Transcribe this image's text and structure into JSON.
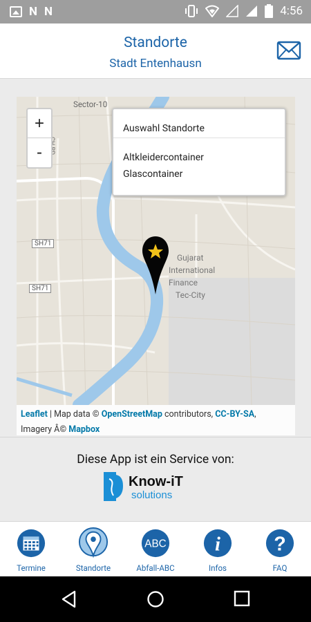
{
  "status_bar": {
    "left_icons": [
      "image-icon",
      "n-icon",
      "n-icon"
    ],
    "right_icons": [
      "vibrate-icon",
      "wifi-icon",
      "signal-empty-icon",
      "signal-full-icon",
      "battery-icon"
    ],
    "time": "4:56"
  },
  "header": {
    "title": "Standorte",
    "subtitle": "Stadt Entenhausn",
    "mail_icon": "mail-icon"
  },
  "map": {
    "zoom_in": "+",
    "zoom_out": "-",
    "layers": {
      "title": "Auswahl Standorte",
      "options": [
        "Altkleidercontainer",
        "Glascontainer"
      ]
    },
    "labels": {
      "sector": "Sector-10",
      "road1": "SH71",
      "road2": "SH71",
      "place1": "Gujarat",
      "place2": "International",
      "place3": "Finance",
      "place4": "Tec-City",
      "road3": "CH RD"
    },
    "marker_icon": "star-marker-icon",
    "attribution": {
      "leaflet": "Leaflet",
      "sep1": " | Map data © ",
      "osm": "OpenStreetMap",
      "contrib": " contributors, ",
      "license": "CC-BY-SA",
      "comma": ",",
      "imagery": "Imagery Â© ",
      "mapbox": "Mapbox"
    }
  },
  "service": {
    "text": "Diese App ist ein Service von:",
    "logo_name": "Know-iT",
    "logo_sub": "solutions"
  },
  "bottom_nav": [
    {
      "label": "Termine",
      "icon": "calendar-icon"
    },
    {
      "label": "Standorte",
      "icon": "location-pin-icon"
    },
    {
      "label": "Abfall-ABC",
      "icon": "abc-icon",
      "icon_text": "ABC"
    },
    {
      "label": "Infos",
      "icon": "info-icon",
      "icon_text": "i"
    },
    {
      "label": "FAQ",
      "icon": "help-icon",
      "icon_text": "?"
    }
  ],
  "colors": {
    "accent": "#1c64a8",
    "river": "#9ec8ea",
    "map_bg": "#e7e3da"
  }
}
